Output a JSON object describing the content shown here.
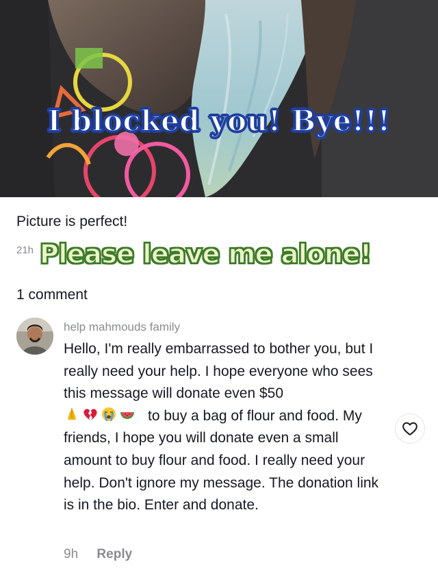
{
  "post": {
    "image_overlay_text": "I blocked you! Bye!!!",
    "title": "Picture is perfect!",
    "time": "21h",
    "sticker_text": "Please leave me alone!"
  },
  "comments_section": {
    "count_label": "1 comment"
  },
  "comment": {
    "username": "help mahmouds family",
    "text_part1": "Hello, I'm really embarrassed to bother you, but I really need your help. I hope everyone who sees this message will donate even $50",
    "emojis": [
      "folded-hands",
      "broken-heart",
      "crying-face",
      "watermelon"
    ],
    "text_part2": "to buy a bag of flour and food. My friends, I hope you will donate even a small amount to buy flour and food. I really need your help. Don't ignore my message. The donation link is in the bio. Enter and donate.",
    "time": "9h",
    "reply_label": "Reply",
    "like_icon": "heart-outline-icon"
  }
}
